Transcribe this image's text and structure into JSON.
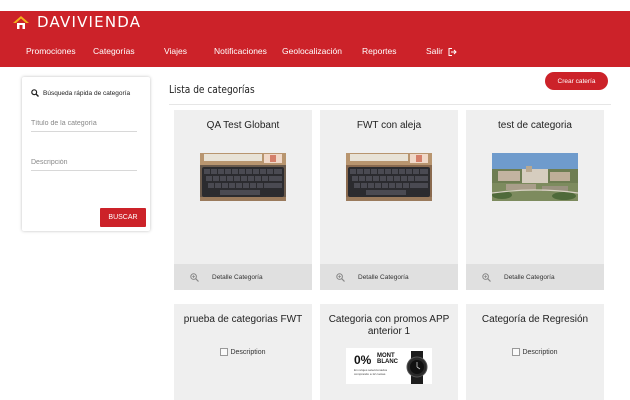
{
  "brand": {
    "name": "DAVIVIENDA",
    "color": "#cc2229",
    "logo_icon": "house-roof-icon"
  },
  "nav": {
    "items": [
      {
        "label": "Promociones"
      },
      {
        "label": "Categorías"
      },
      {
        "label": "Viajes"
      },
      {
        "label": "Notificaciones"
      },
      {
        "label": "Geolocalización"
      },
      {
        "label": "Reportes"
      },
      {
        "label": "Salir",
        "icon": "logout-icon"
      }
    ]
  },
  "filter": {
    "heading": "Búsqueda rápida de categoría",
    "title_placeholder": "Título de la categoría",
    "description_placeholder": "Descripción",
    "search_button": "BUSCAR"
  },
  "main": {
    "title": "Lista de categorías",
    "create_button": "Crear catería"
  },
  "cards": [
    {
      "title": "QA Test Globant",
      "image": "laptop-keyboard-photo",
      "footer": "Detalle Categoría"
    },
    {
      "title": "FWT con aleja",
      "image": "laptop-keyboard-photo",
      "footer": "Detalle Categoría"
    },
    {
      "title": "test de categoria",
      "image": "campus-aerial-photo",
      "footer": "Detalle Categoría"
    },
    {
      "title": "prueba de categorias FWT",
      "image_alt": "Description"
    },
    {
      "title": "Categoria con promos APP anterior 1",
      "image": "montblanc-promo-banner",
      "promo": {
        "percent": "0%",
        "brand_line1": "MONT",
        "brand_line2": "BLANC",
        "fine_print": "En relojes seleccionados comprando a 12 cuotas"
      }
    },
    {
      "title": "Categoría de Regresión",
      "image_alt": "Description"
    }
  ]
}
